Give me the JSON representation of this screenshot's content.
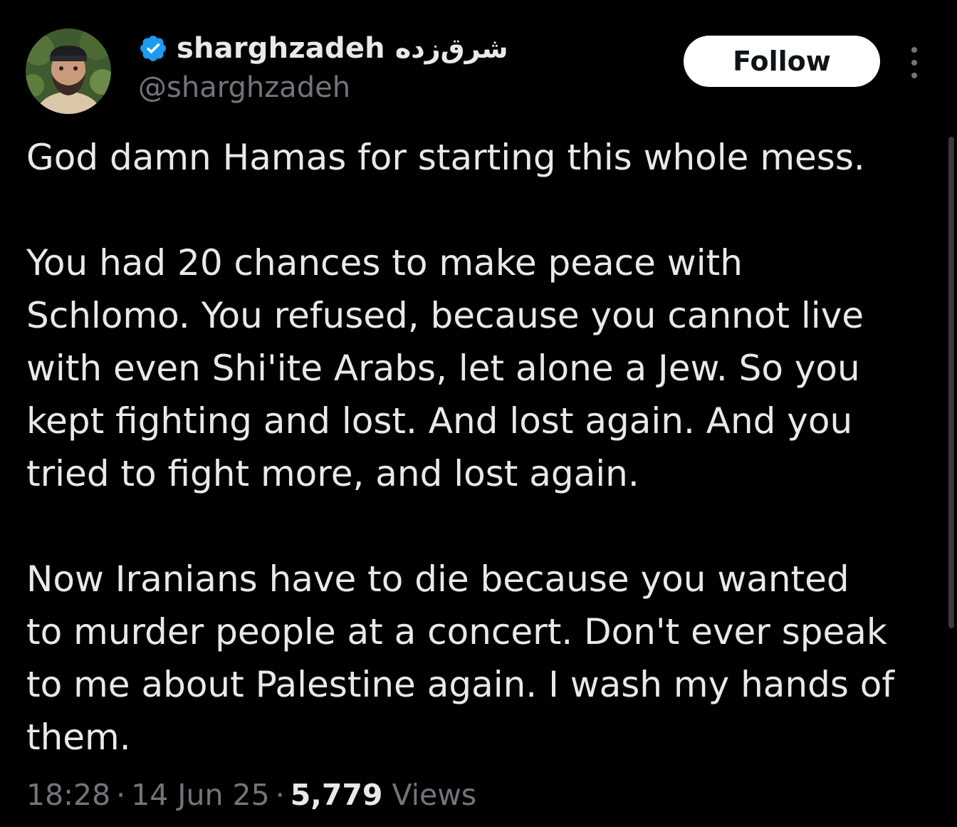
{
  "author": {
    "display_name": "sharghzadeh",
    "display_name_fa": "شرق‌زده",
    "handle": "@sharghzadeh",
    "verified": true,
    "verified_icon": "verified-badge-icon"
  },
  "actions": {
    "follow_label": "Follow",
    "more_icon": "more-vertical-icon"
  },
  "tweet": {
    "paragraphs": [
      [
        "God damn Hamas for starting this whole mess."
      ],
      [
        "You had 20 chances to make peace with",
        "Schlomo. You refused, because you cannot live",
        "with even Shi'ite Arabs, let alone a Jew. So you",
        "kept fighting and lost. And lost again. And you",
        "tried to fight more, and lost again."
      ],
      [
        "Now Iranians have to die because you wanted",
        "to murder people at a concert. Don't ever speak",
        "to me about Palestine again. I wash my hands of",
        "them."
      ]
    ]
  },
  "meta": {
    "time": "18:28",
    "date": "14 Jun 25",
    "views_count": "5,779",
    "views_label": "Views"
  },
  "colors": {
    "background": "#000000",
    "text": "#e7e9ea",
    "secondary": "#71767b",
    "verified": "#1d9bf0"
  }
}
